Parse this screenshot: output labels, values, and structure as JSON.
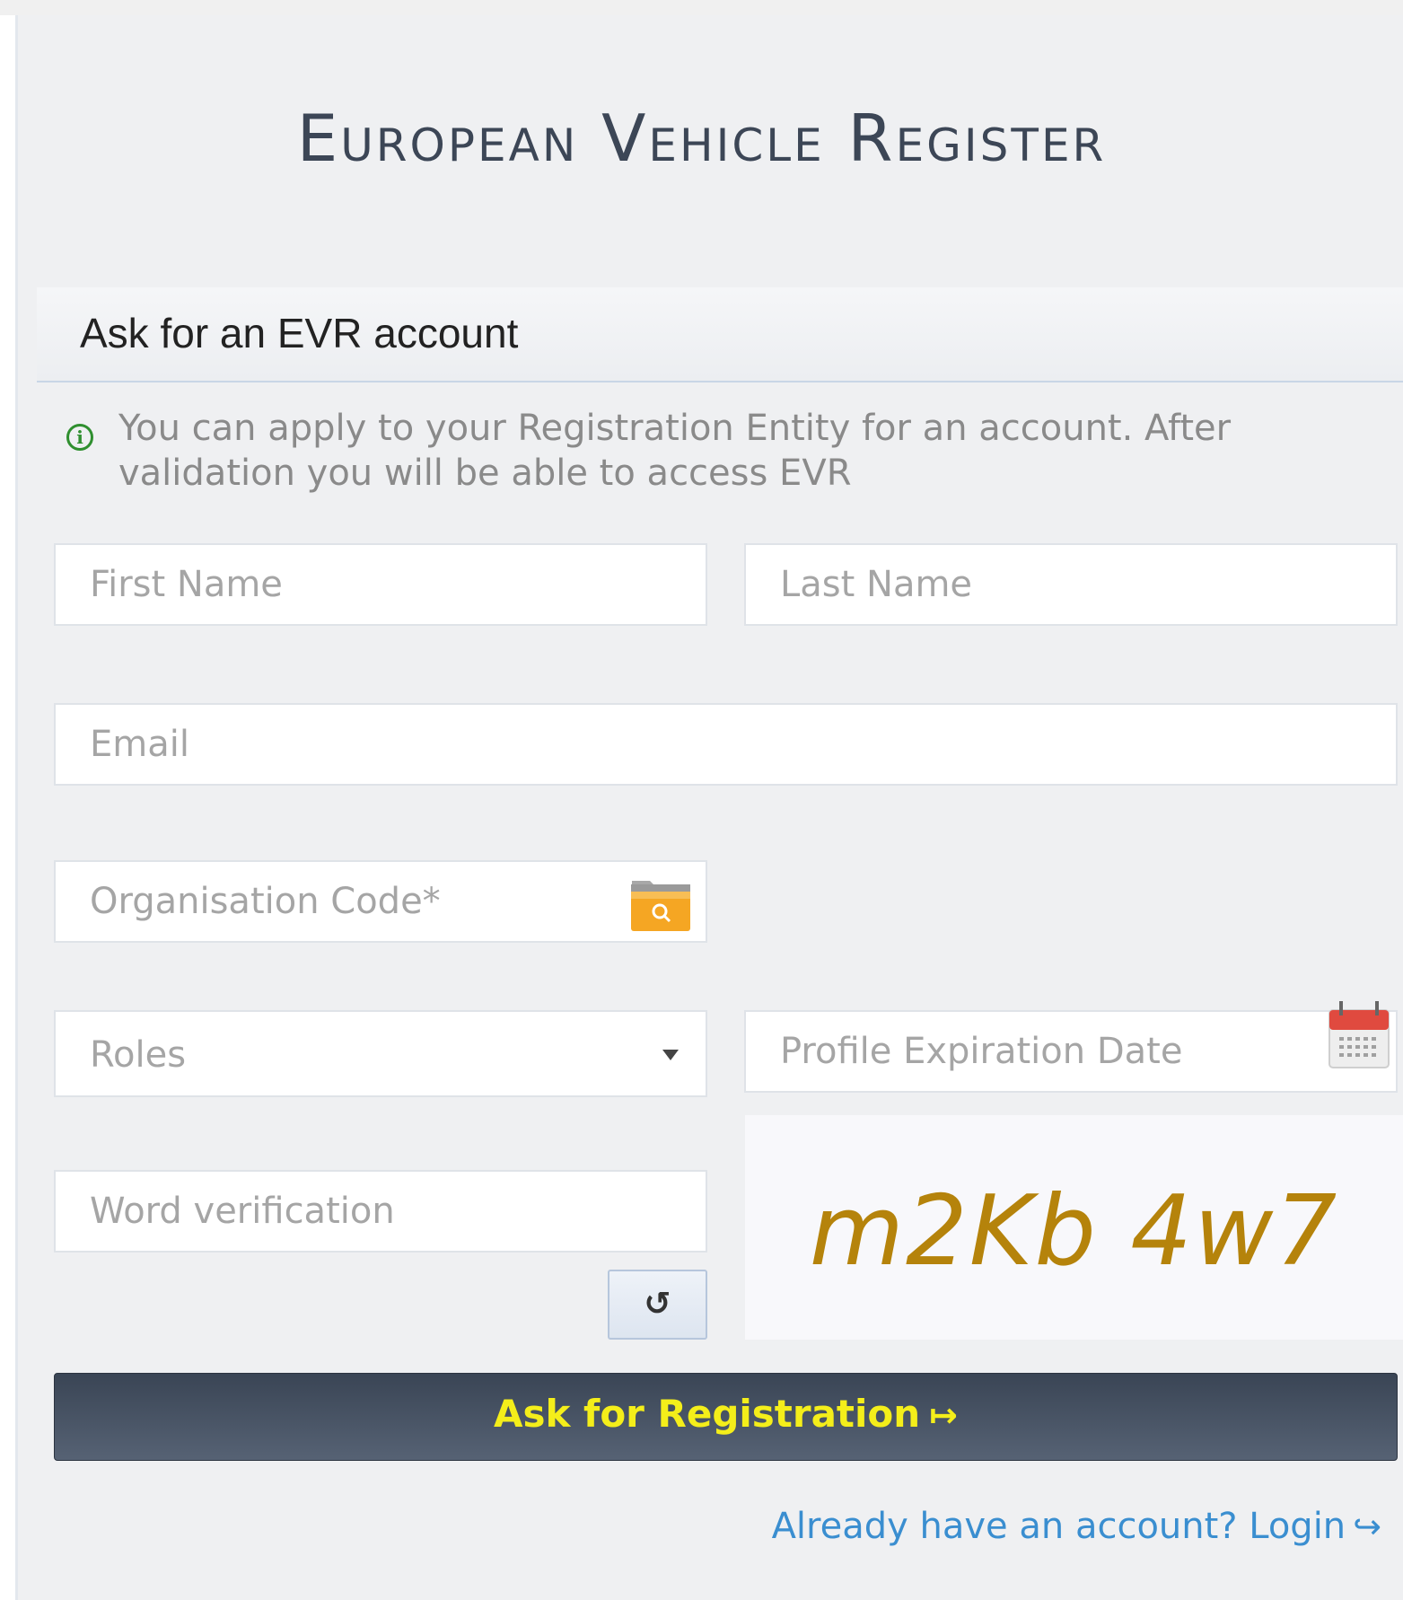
{
  "page": {
    "title": "European Vehicle Register"
  },
  "section": {
    "title": "Ask for an EVR account",
    "info_text": "You can apply to your Registration Entity for an account. After validation you will be able to access EVR",
    "info_icon": "info-icon"
  },
  "form": {
    "first_name_placeholder": "First Name",
    "last_name_placeholder": "Last Name",
    "email_placeholder": "Email",
    "org_code_placeholder": "Organisation Code*",
    "roles_label": "Roles",
    "expiration_placeholder": "Profile Expiration Date",
    "word_verification_placeholder": "Word verification",
    "captcha_text": "m2Kb 4w7",
    "refresh_glyph": "↺",
    "submit_label": "Ask for Registration",
    "submit_icon": "↦",
    "login_link": "Already have an account? Login",
    "login_icon": "↪"
  },
  "colors": {
    "panel_bg": "#eff0f2",
    "title": "#3c4656",
    "button_bg": "#3a4555",
    "button_text": "#f4ee1a",
    "link": "#3a8ed0",
    "captcha": "#b5830b",
    "info_icon": "#2f8f2f"
  }
}
